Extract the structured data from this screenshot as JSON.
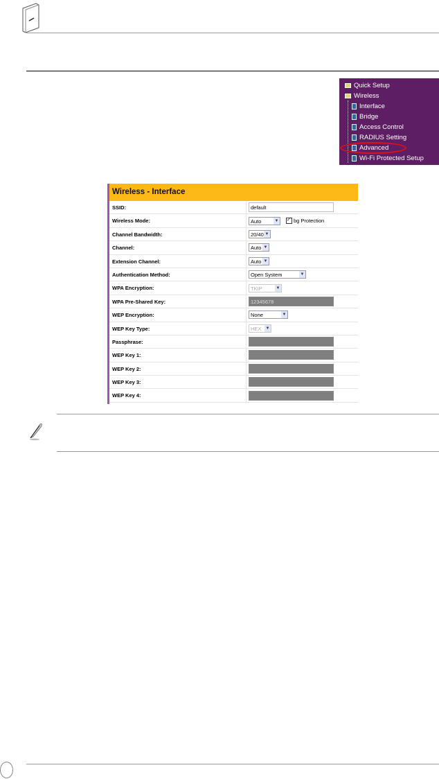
{
  "menu": {
    "items": [
      {
        "label": "Quick Setup",
        "icon": "folder-icon"
      },
      {
        "label": "Wireless",
        "icon": "folder-open-icon"
      },
      {
        "label": "Interface",
        "icon": "page-icon"
      },
      {
        "label": "Bridge",
        "icon": "page-icon"
      },
      {
        "label": "Access Control",
        "icon": "page-icon"
      },
      {
        "label": "RADIUS Setting",
        "icon": "page-icon"
      },
      {
        "label": "Advanced",
        "icon": "page-icon",
        "highlighted": true
      },
      {
        "label": "Wi-Fi Protected Setup",
        "icon": "page-icon"
      }
    ]
  },
  "form": {
    "title": "Wireless - Interface",
    "ssid": {
      "label": "SSID:",
      "value": "default"
    },
    "wireless_mode": {
      "label": "Wireless Mode:",
      "value": "Auto",
      "checkbox_label": "bg Protection",
      "checked": true
    },
    "channel_bandwidth": {
      "label": "Channel Bandwidth:",
      "value": "20/40"
    },
    "channel": {
      "label": "Channel:",
      "value": "Auto"
    },
    "extension_channel": {
      "label": "Extension Channel:",
      "value": "Auto"
    },
    "auth_method": {
      "label": "Authentication Method:",
      "value": "Open System"
    },
    "wpa_encryption": {
      "label": "WPA Encryption:",
      "value": "TKIP"
    },
    "wpa_psk": {
      "label": "WPA Pre-Shared Key:",
      "value": "12345678"
    },
    "wep_encryption": {
      "label": "WEP Encryption:",
      "value": "None"
    },
    "wep_key_type": {
      "label": "WEP Key Type:",
      "value": "HEX"
    },
    "passphrase": {
      "label": "Passphrase:",
      "value": ""
    },
    "wep_key1": {
      "label": "WEP Key 1:",
      "value": ""
    },
    "wep_key2": {
      "label": "WEP Key 2:",
      "value": ""
    },
    "wep_key3": {
      "label": "WEP Key 3:",
      "value": ""
    },
    "wep_key4": {
      "label": "WEP Key 4:",
      "value": ""
    }
  },
  "colors": {
    "header": "#fbb817",
    "menu_bg": "#5e1e63",
    "highlight": "#e0101a"
  }
}
